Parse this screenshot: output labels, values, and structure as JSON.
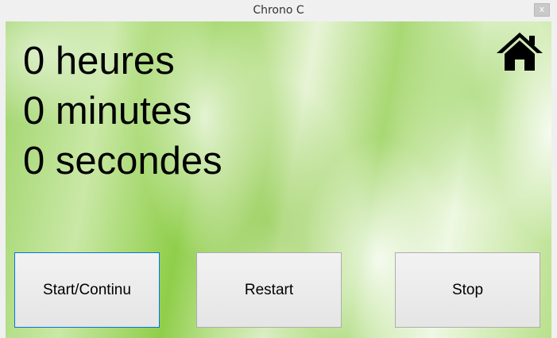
{
  "window": {
    "title": "Chrono C",
    "close_label": "x"
  },
  "timer": {
    "hours": "0 heures",
    "minutes": "0 minutes",
    "seconds": "0 secondes"
  },
  "icons": {
    "home": "home-icon"
  },
  "buttons": {
    "start": "Start/Continu",
    "restart": "Restart",
    "stop": "Stop"
  }
}
